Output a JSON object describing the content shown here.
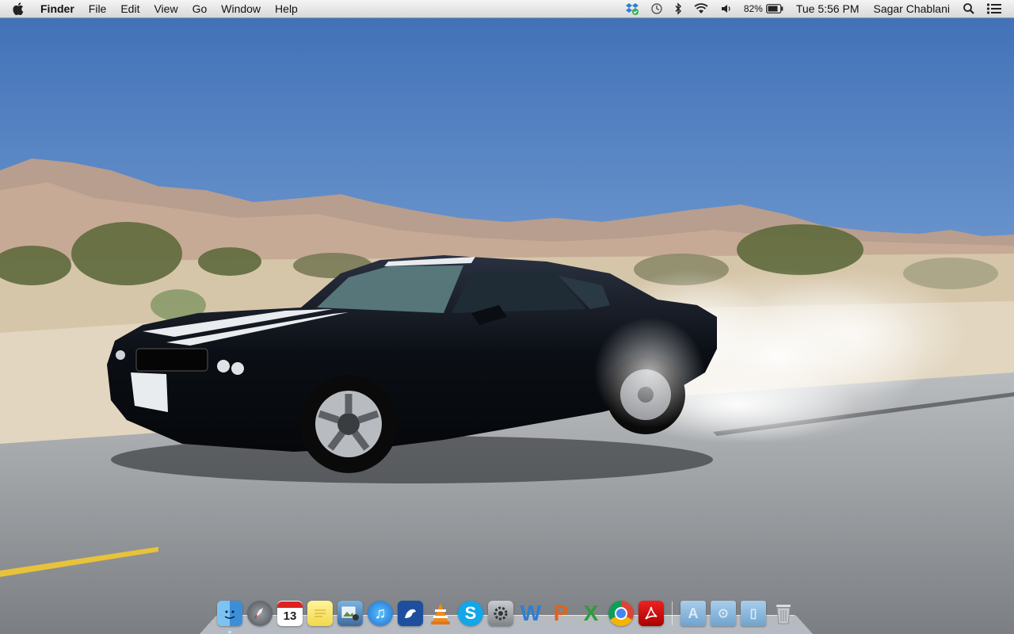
{
  "menubar": {
    "app_name": "Finder",
    "menus": [
      "File",
      "Edit",
      "View",
      "Go",
      "Window",
      "Help"
    ],
    "battery_percent": "82%",
    "clock": "Tue 5:56 PM",
    "user_name": "Sagar Chablani",
    "status_icons": [
      "dropbox-icon",
      "time-machine-icon",
      "bluetooth-icon",
      "wifi-icon",
      "volume-icon",
      "battery-icon",
      "spotlight-icon",
      "notification-center-icon"
    ]
  },
  "wallpaper": {
    "subject": "black muscle car with white racing stripes doing a burnout on desert road"
  },
  "dock": {
    "apps": [
      {
        "name": "finder",
        "running": true
      },
      {
        "name": "launchpad",
        "running": false
      },
      {
        "name": "calendar",
        "label": "13",
        "running": false
      },
      {
        "name": "stickies",
        "running": false
      },
      {
        "name": "iphoto",
        "running": false
      },
      {
        "name": "itunes",
        "running": false
      },
      {
        "name": "cyberduck",
        "running": false
      },
      {
        "name": "vlc",
        "running": false
      },
      {
        "name": "skype",
        "running": false
      },
      {
        "name": "system-preferences",
        "running": false
      },
      {
        "name": "microsoft-word",
        "label": "W",
        "running": false
      },
      {
        "name": "microsoft-powerpoint",
        "label": "P",
        "running": false
      },
      {
        "name": "microsoft-excel",
        "label": "X",
        "running": false
      },
      {
        "name": "google-chrome",
        "running": false
      },
      {
        "name": "adobe-reader",
        "running": false
      }
    ],
    "folders": [
      "applications-folder",
      "downloads-folder",
      "documents-folder",
      "trash"
    ]
  },
  "colors": {
    "sky": "#4a78bd",
    "road": "#9a9ca0",
    "car": "#0c1016",
    "stripe": "#e9ecef"
  }
}
